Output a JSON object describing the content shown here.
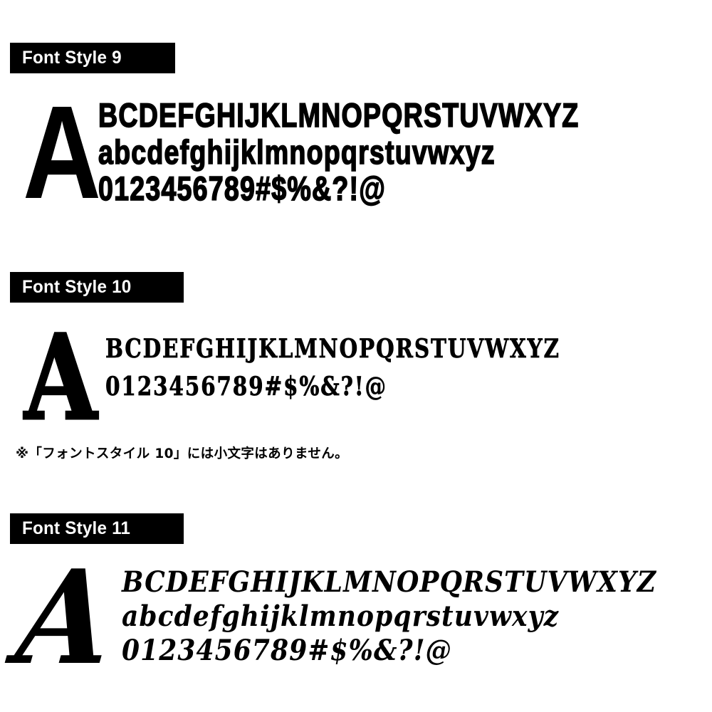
{
  "page": {
    "background_color": "#ffffff",
    "text_color": "#000000",
    "header_bar_color": "#000000",
    "header_text_color": "#ffffff"
  },
  "sections": [
    {
      "header_label": "Font Style 9",
      "display_letter": "A",
      "rows": {
        "uppercase": "BCDEFGHIJKLMNOPQRSTUVWXYZ",
        "lowercase": "abcdefghijklmnopqrstuvwxyz",
        "numerals": "0123456789#$%&?!@"
      },
      "has_lowercase": true,
      "style_description": "ultra-bold condensed grotesque sans"
    },
    {
      "header_label": "Font Style 10",
      "display_letter": "A",
      "rows": {
        "uppercase": "BCDEFGHIJKLMNOPQRSTUVWXYZ",
        "lowercase": "",
        "numerals": "0123456789#$%&?!@"
      },
      "has_lowercase": false,
      "style_description": "western circus slab serif"
    },
    {
      "header_label": "Font Style 11",
      "display_letter": "A",
      "rows": {
        "uppercase": "BCDEFGHIJKLMNOPQRSTUVWXYZ",
        "lowercase": "abcdefghijklmnopqrstuvwxyz",
        "numerals": "0123456789#$%&?!@"
      },
      "has_lowercase": true,
      "style_description": "bold italic script serif"
    }
  ],
  "notes": {
    "no_lowercase_note": "※「フォントスタイル 10」には小文字はありません。"
  }
}
